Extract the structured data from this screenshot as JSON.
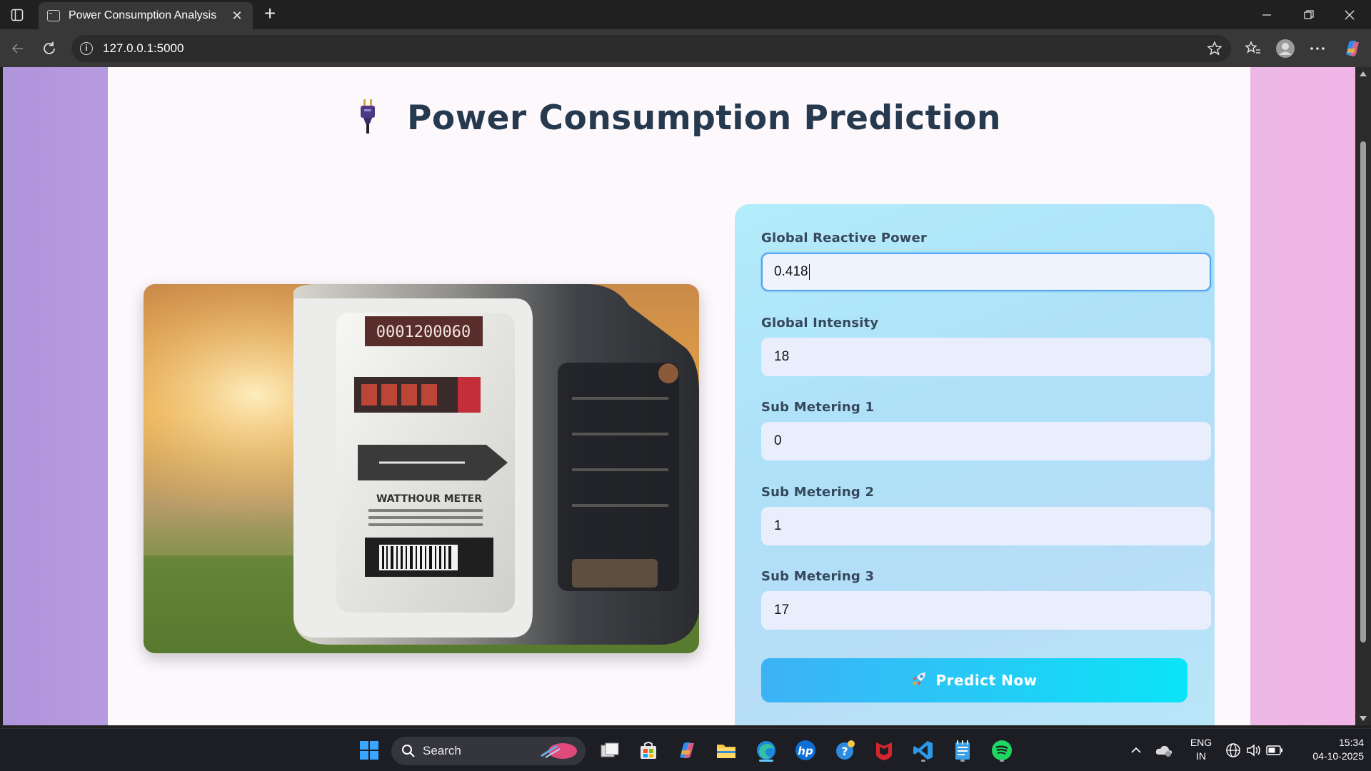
{
  "browser": {
    "tab_title": "Power Consumption Analysis",
    "url": "127.0.0.1:5000"
  },
  "page": {
    "title": "Power Consumption Prediction",
    "form": {
      "fields": [
        {
          "label": "Global Reactive Power",
          "value": "0.418"
        },
        {
          "label": "Global Intensity",
          "value": "18"
        },
        {
          "label": "Sub Metering 1",
          "value": "0"
        },
        {
          "label": "Sub Metering 2",
          "value": "1"
        },
        {
          "label": "Sub Metering 3",
          "value": "17"
        }
      ],
      "submit_label": "Predict Now",
      "submit_icon": "rocket-icon"
    },
    "image": {
      "meter_serial": "0001200060",
      "meter_label": "WATTHOUR METER"
    }
  },
  "taskbar": {
    "search_label": "Search",
    "language": "ENG",
    "region": "IN",
    "time": "15:34",
    "date": "04-10-2025"
  },
  "colors": {
    "title": "#26394f",
    "button_start": "#3db2f5",
    "button_end": "#0ae4f8",
    "panel": "#b3ecfb",
    "focus_border": "#4da3ec"
  }
}
